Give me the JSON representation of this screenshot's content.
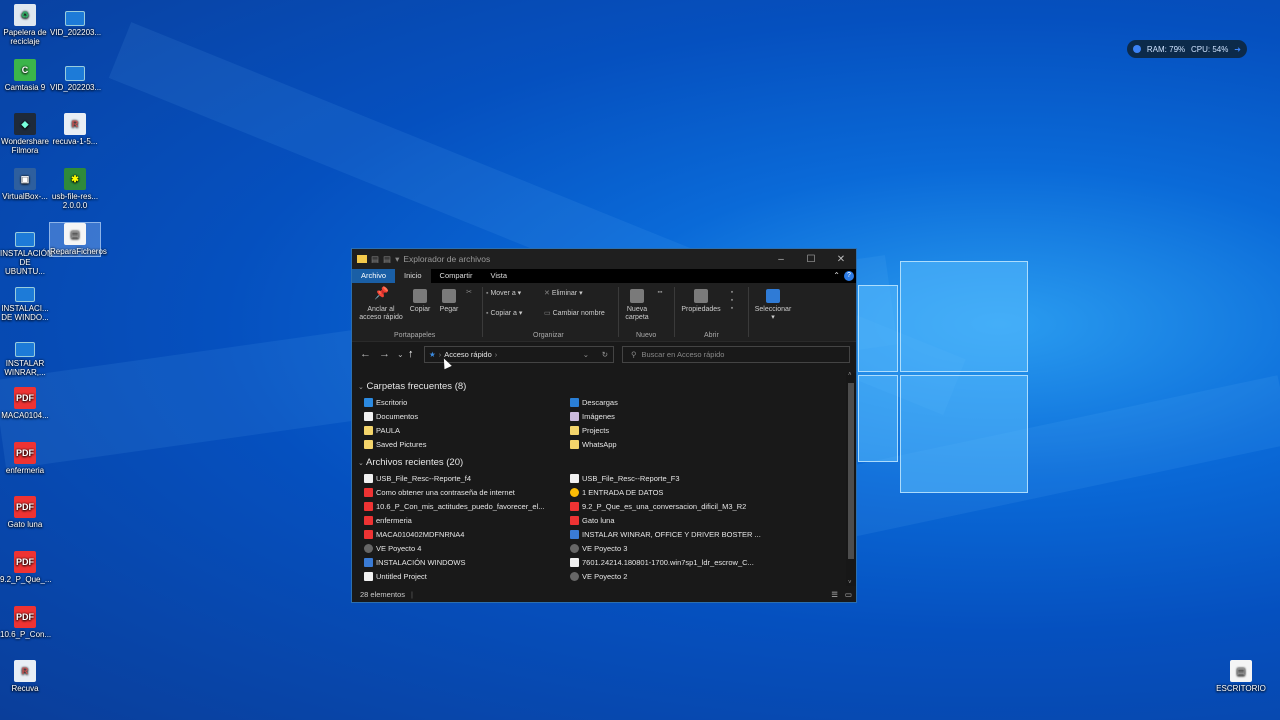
{
  "desktop": {
    "icons": [
      {
        "label": "Papelera de reciclaje",
        "glyph": "♻",
        "icon": "recycle-bin-icon"
      },
      {
        "label": "VID_202203...",
        "glyph": "",
        "icon": "video-file-icon"
      },
      {
        "label": "Camtasia 9",
        "glyph": "C",
        "icon": "camtasia-icon"
      },
      {
        "label": "VID_202203...",
        "glyph": "",
        "icon": "video-file-icon"
      },
      {
        "label": "Wondershare Filmora",
        "glyph": "◆",
        "icon": "filmora-icon"
      },
      {
        "label": "recuva-1-5...",
        "glyph": "R",
        "icon": "recuva-installer-icon"
      },
      {
        "label": "VirtualBox-...",
        "glyph": "▣",
        "icon": "virtualbox-icon"
      },
      {
        "label": "usb-file-res... 2.0.0.0",
        "glyph": "✱",
        "icon": "usb-file-resc-icon"
      },
      {
        "label": "INSTALACIÓN DE UBUNTU...",
        "glyph": "",
        "icon": "video-file-icon"
      },
      {
        "label": "ReparaFicheros",
        "glyph": "▤",
        "icon": "document-icon"
      },
      {
        "label": "INSTALACI... DE WINDO...",
        "glyph": "",
        "icon": "video-file-icon"
      },
      {
        "label": "INSTALAR WINRAR,...",
        "glyph": "",
        "icon": "video-file-icon"
      },
      {
        "label": "MACA0104...",
        "glyph": "PDF",
        "icon": "pdf-file-icon"
      },
      {
        "label": "enfermeria",
        "glyph": "PDF",
        "icon": "pdf-file-icon"
      },
      {
        "label": "Gato luna",
        "glyph": "PDF",
        "icon": "pdf-file-icon"
      },
      {
        "label": "9.2_P_Que_...",
        "glyph": "PDF",
        "icon": "pdf-file-icon"
      },
      {
        "label": "10.6_P_Con...",
        "glyph": "PDF",
        "icon": "pdf-file-icon"
      },
      {
        "label": "Recuva",
        "glyph": "R",
        "icon": "recuva-icon"
      },
      {
        "label": "ESCRITORIO",
        "glyph": "▤",
        "icon": "document-icon"
      }
    ],
    "sysmon": {
      "ram": "RAM: 79%",
      "cpu": "CPU: 54%"
    }
  },
  "explorer": {
    "title": "Explorador de archivos",
    "tabs": [
      "Archivo",
      "Inicio",
      "Compartir",
      "Vista"
    ],
    "ribbon": {
      "pin": "Anclar al acceso rápido",
      "copy": "Copiar",
      "paste": "Pegar",
      "move_to": "Mover a",
      "copy_to": "Copiar a",
      "delete": "Eliminar",
      "rename": "Cambiar nombre",
      "new_folder": "Nueva carpeta",
      "properties": "Propiedades",
      "select": "Seleccionar",
      "groups": [
        "Portapapeles",
        "Organizar",
        "Nuevo",
        "Abrir"
      ]
    },
    "address": "Acceso rápido",
    "search_placeholder": "Buscar en Acceso rápido",
    "frequent_header": "Carpetas frecuentes (8)",
    "frequent": [
      {
        "name": "Escritorio",
        "type": "fi-blue"
      },
      {
        "name": "Descargas",
        "type": "fi-dl"
      },
      {
        "name": "Documentos",
        "type": "fi-doc"
      },
      {
        "name": "Imágenes",
        "type": "fi-img"
      },
      {
        "name": "PAULA",
        "type": "fi-folder"
      },
      {
        "name": "Projects",
        "type": "fi-folder"
      },
      {
        "name": "Saved Pictures",
        "type": "fi-folder"
      },
      {
        "name": "WhatsApp",
        "type": "fi-folder"
      }
    ],
    "recent_header": "Archivos recientes (20)",
    "recent": [
      {
        "name": "USB_File_Resc--Reporte_f4",
        "type": "fi-doc"
      },
      {
        "name": "USB_File_Resc--Reporte_F3",
        "type": "fi-doc"
      },
      {
        "name": "Como obtener una contraseña de internet",
        "type": "fi-pdf"
      },
      {
        "name": "1 ENTRADA DE DATOS",
        "type": "fi-chrome"
      },
      {
        "name": "10.6_P_Con_mis_actitudes_puedo_favorecer_el...",
        "type": "fi-pdf"
      },
      {
        "name": "9.2_P_Que_es_una_conversacion_dificil_M3_R2",
        "type": "fi-pdf"
      },
      {
        "name": "enfermeria",
        "type": "fi-pdf"
      },
      {
        "name": "Gato luna",
        "type": "fi-pdf"
      },
      {
        "name": "MACA010402MDFNRNA4",
        "type": "fi-pdf"
      },
      {
        "name": "INSTALAR WINRAR, OFFICE Y DRIVER BOSTER ...",
        "type": "fi-win"
      },
      {
        "name": "VE Poyecto 4",
        "type": "fi-ve"
      },
      {
        "name": "VE Poyecto 3",
        "type": "fi-ve"
      },
      {
        "name": "INSTALACIÓN WINDOWS",
        "type": "fi-win"
      },
      {
        "name": "7601.24214.180801-1700.win7sp1_ldr_escrow_C...",
        "type": "fi-doc"
      },
      {
        "name": "Untitled Project",
        "type": "fi-doc"
      },
      {
        "name": "VE Poyecto 2",
        "type": "fi-ve"
      }
    ],
    "status": "28 elementos"
  }
}
